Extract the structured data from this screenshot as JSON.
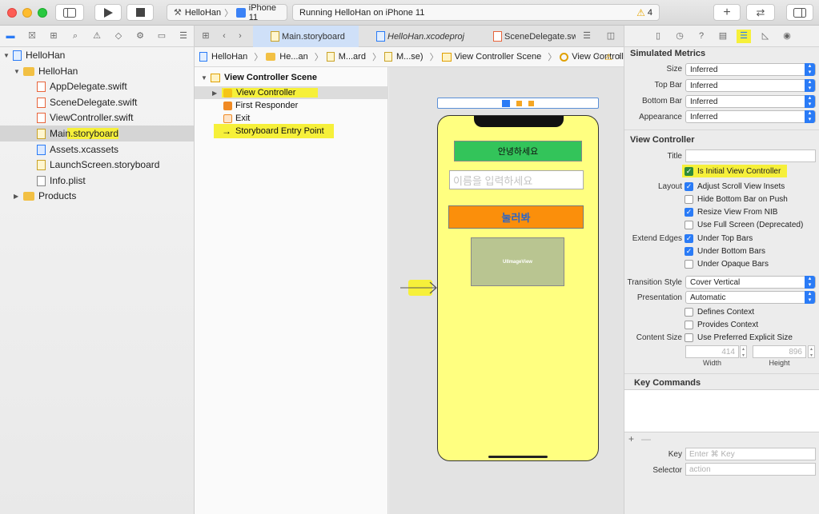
{
  "toolbar": {
    "scheme_target": "HelloHan",
    "scheme_device": "iPhone 11",
    "status": "Running HelloHan on iPhone 11",
    "warning_count": "4"
  },
  "navigator": {
    "items": [
      {
        "label": "HelloHan",
        "kind": "project"
      },
      {
        "label": "HelloHan",
        "kind": "folder"
      },
      {
        "label": "AppDelegate.swift",
        "kind": "swift"
      },
      {
        "label": "SceneDelegate.swift",
        "kind": "swift"
      },
      {
        "label": "ViewController.swift",
        "kind": "swift"
      },
      {
        "label": "Main.storyboard",
        "kind": "storyboard"
      },
      {
        "label": "Assets.xcassets",
        "kind": "assets"
      },
      {
        "label": "LaunchScreen.storyboard",
        "kind": "storyboard"
      },
      {
        "label": "Info.plist",
        "kind": "plist"
      },
      {
        "label": "Products",
        "kind": "folder"
      }
    ]
  },
  "tabs": [
    "Main.storyboard",
    "HelloHan.xcodeproj",
    "SceneDelegate.sw"
  ],
  "jumpbar": [
    "HelloHan",
    "He...an",
    "M...ard",
    "M...se)",
    "View Controller Scene",
    "View Controller"
  ],
  "outline": {
    "scene": "View Controller Scene",
    "items": [
      "View Controller",
      "First Responder",
      "Exit",
      "Storyboard Entry Point"
    ]
  },
  "canvas": {
    "greeting_label": "안녕하세요",
    "name_placeholder": "이름을 입력하세요",
    "button_label": "눌러봐",
    "image_view_label": "UIImageView"
  },
  "inspector": {
    "simulated_metrics": {
      "title": "Simulated Metrics",
      "rows": [
        {
          "label": "Size",
          "value": "Inferred"
        },
        {
          "label": "Top Bar",
          "value": "Inferred"
        },
        {
          "label": "Bottom Bar",
          "value": "Inferred"
        },
        {
          "label": "Appearance",
          "value": "Inferred"
        }
      ]
    },
    "view_controller": {
      "title": "View Controller",
      "title_label": "Title",
      "initial_vc": "Is Initial View Controller",
      "layout_label": "Layout",
      "layout": [
        {
          "label": "Adjust Scroll View Insets",
          "checked": true
        },
        {
          "label": "Hide Bottom Bar on Push",
          "checked": false
        },
        {
          "label": "Resize View From NIB",
          "checked": true
        },
        {
          "label": "Use Full Screen (Deprecated)",
          "checked": false
        }
      ],
      "extend_label": "Extend Edges",
      "extend": [
        {
          "label": "Under Top Bars",
          "checked": true
        },
        {
          "label": "Under Bottom Bars",
          "checked": true
        },
        {
          "label": "Under Opaque Bars",
          "checked": false
        }
      ],
      "transition_label": "Transition Style",
      "transition_value": "Cover Vertical",
      "presentation_label": "Presentation",
      "presentation_value": "Automatic",
      "defines_context": "Defines Context",
      "provides_context": "Provides Context",
      "content_size_label": "Content Size",
      "use_preferred": "Use Preferred Explicit Size",
      "width_value": "414",
      "height_value": "896",
      "width_label": "Width",
      "height_label": "Height"
    },
    "key_commands": {
      "title": "Key Commands",
      "key_label": "Key",
      "key_placeholder": "Enter ⌘ Key",
      "selector_label": "Selector",
      "selector_placeholder": "action"
    }
  },
  "colors": {
    "highlight": "#f6f03a",
    "accent": "#2a7bf6",
    "phone_bg": "#ffff80",
    "label_green": "#33c45a",
    "button_orange": "#fb8f0b"
  }
}
